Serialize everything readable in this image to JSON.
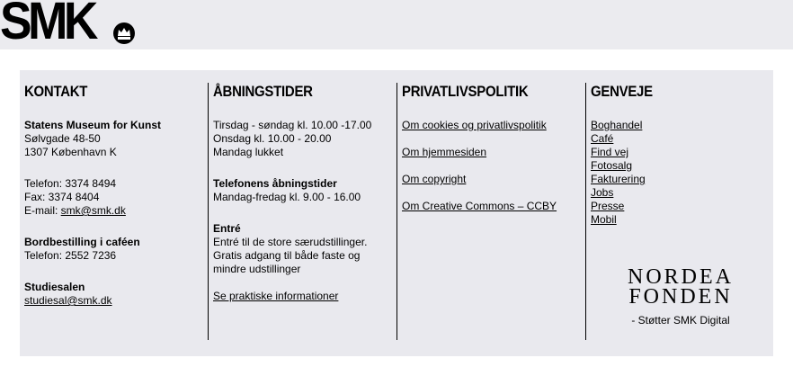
{
  "header": {
    "logo_text": "SMK",
    "crown_icon": "crown-icon"
  },
  "kontakt": {
    "heading": "KONTAKT",
    "org_name": "Statens Museum for Kunst",
    "street": "Sølvgade 48-50",
    "city": "1307 København K",
    "phone": "Telefon: 3374 8494",
    "fax": "Fax: 3374 8404",
    "email_label": "E-mail: ",
    "email": "smk@smk.dk",
    "cafe_title": "Bordbestilling i caféen",
    "cafe_phone": "Telefon: 2552 7236",
    "study_title": "Studiesalen",
    "study_email": "studiesal@smk.dk"
  },
  "hours": {
    "heading": "ÅBNINGSTIDER",
    "line1": "Tirsdag - søndag kl. 10.00 -17.00",
    "line2": "Onsdag kl. 10.00 - 20.00",
    "line3": "Mandag lukket",
    "phone_title": "Telefonens åbningstider",
    "phone_hours": "Mandag-fredag kl. 9.00 - 16.00",
    "entry_title": "Entré",
    "entry_1": "Entré til de store særudstillinger.",
    "entry_2": "Gratis adgang til både faste og",
    "entry_3": "mindre udstillinger",
    "practical_link": "Se praktiske informationer"
  },
  "privacy": {
    "heading": "PRIVATLIVSPOLITIK",
    "links": [
      "Om cookies og privatlivspolitik",
      "Om hjemmesiden",
      "Om copyright",
      "Om Creative Commons – CCBY"
    ]
  },
  "shortcuts": {
    "heading": "GENVEJE",
    "links": [
      "Boghandel",
      "Café",
      "Find vej",
      "Fotosalg",
      "Fakturering",
      "Jobs",
      "Presse",
      "Mobil"
    ]
  },
  "sponsor": {
    "line1": "NORDEA",
    "line2": "FONDEN",
    "caption": "- Støtter SMK Digital"
  }
}
